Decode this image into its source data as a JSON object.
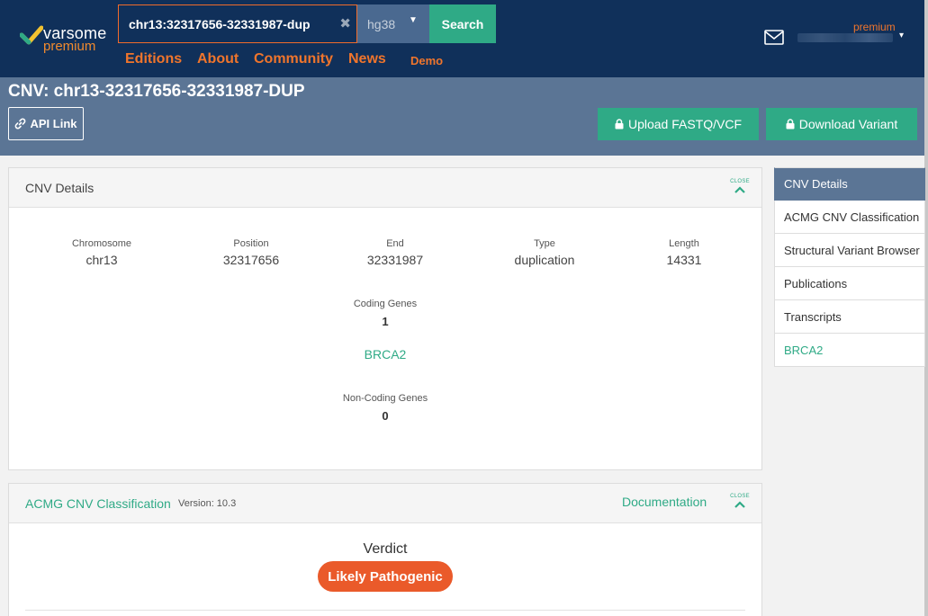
{
  "brand": {
    "word1": "varsome",
    "word2": "premium"
  },
  "search": {
    "value": "chr13:32317656-32331987-dup",
    "clear_icon": "close-icon",
    "genome": "hg38",
    "button": "Search"
  },
  "nav": [
    "Editions",
    "About",
    "Community",
    "News",
    "Demo"
  ],
  "user": {
    "badge": "premium",
    "mail_icon": "envelope-icon"
  },
  "title": "CNV: chr13-32317656-32331987-DUP",
  "actions": {
    "api": "API Link",
    "upload": "Upload FASTQ/VCF",
    "download": "Download Variant"
  },
  "cnv_details": {
    "title": "CNV Details",
    "close": "CLOSE",
    "chromosome": {
      "label": "Chromosome",
      "value": "chr13"
    },
    "position": {
      "label": "Position",
      "value": "32317656"
    },
    "end": {
      "label": "End",
      "value": "32331987"
    },
    "type": {
      "label": "Type",
      "value": "duplication"
    },
    "length": {
      "label": "Length",
      "value": "14331"
    },
    "coding_genes": {
      "label": "Coding Genes",
      "value": "1",
      "genes": [
        "BRCA2"
      ]
    },
    "non_coding_genes": {
      "label": "Non-Coding Genes",
      "value": "0"
    }
  },
  "acmg": {
    "title": "ACMG CNV Classification",
    "version": "Version: 10.3",
    "documentation": "Documentation",
    "close": "CLOSE",
    "verdict_label": "Verdict",
    "verdict": "Likely Pathogenic"
  },
  "sidebar": [
    "CNV Details",
    "ACMG CNV Classification",
    "Structural Variant Browser",
    "Publications",
    "Transcripts",
    "BRCA2"
  ],
  "colors": {
    "navy": "#10305a",
    "band": "#5b7595",
    "accent": "#2faa86",
    "orange": "#f0752c",
    "verdict": "#ea5a2a"
  }
}
